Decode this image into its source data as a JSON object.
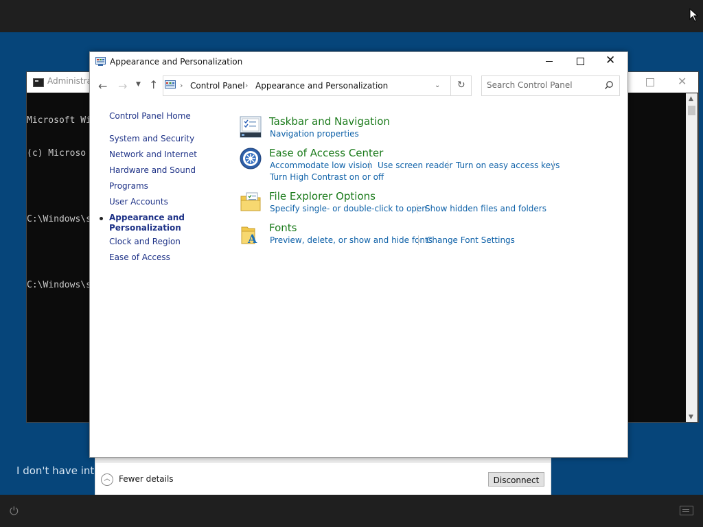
{
  "cmd": {
    "title": "Administrat",
    "lines": [
      "Microsoft Wi",
      "(c) Microso",
      "",
      "C:\\Windows\\s",
      "",
      "C:\\Windows\\s"
    ]
  },
  "oobe_text": "I don't have inter",
  "remote": {
    "fewer_details": "Fewer details",
    "disconnect": "Disconnect"
  },
  "control_panel": {
    "title": "Appearance and Personalization",
    "breadcrumb": [
      "Control Panel",
      "Appearance and Personalization"
    ],
    "search_placeholder": "Search Control Panel",
    "sidebar": {
      "home": "Control Panel Home",
      "items": [
        "System and Security",
        "Network and Internet",
        "Hardware and Sound",
        "Programs",
        "User Accounts",
        "Appearance and\nPersonalization",
        "Clock and Region",
        "Ease of Access"
      ],
      "active_index": 5
    },
    "categories": [
      {
        "title": "Taskbar and Navigation",
        "links": [
          "Navigation properties"
        ],
        "icon": "taskbar-icon"
      },
      {
        "title": "Ease of Access Center",
        "links": [
          "Accommodate low vision",
          "Use screen reader",
          "Turn on easy access keys",
          "Turn High Contrast on or off"
        ],
        "icon": "ease-of-access-icon"
      },
      {
        "title": "File Explorer Options",
        "links": [
          "Specify single- or double-click to open",
          "Show hidden files and folders"
        ],
        "icon": "folder-options-icon"
      },
      {
        "title": "Fonts",
        "links": [
          "Preview, delete, or show and hide fonts",
          "Change Font Settings"
        ],
        "icon": "fonts-icon"
      }
    ]
  },
  "colors": {
    "desktop": "#06457a",
    "category_title": "#1a7a1a",
    "link": "#0e61a8",
    "sidebar_link": "#1e3287"
  }
}
